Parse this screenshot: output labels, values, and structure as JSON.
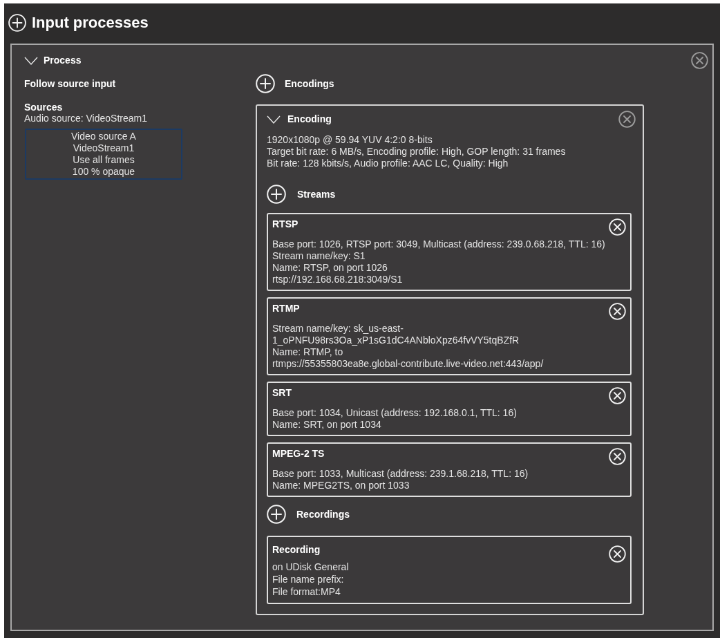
{
  "header": {
    "title": "Input processes"
  },
  "process": {
    "title": "Process",
    "expanded": true,
    "mode": "Follow source input",
    "sources": {
      "title": "Sources",
      "audio": "Audio source: VideoStream1",
      "video": [
        "Video source A",
        "VideoStream1",
        "Use all frames",
        "100 % opaque"
      ]
    },
    "encodings": {
      "title": "Encodings",
      "items": [
        {
          "title": "Encoding",
          "expanded": true,
          "details": [
            "1920x1080p @ 59.94 YUV 4:2:0 8-bits",
            "Target bit rate: 6 MB/s, Encoding profile: High, GOP length: 31 frames",
            "Bit rate: 128 kbits/s, Audio profile: AAC LC, Quality: High"
          ],
          "streams": {
            "title": "Streams",
            "items": [
              {
                "title": "RTSP",
                "lines": [
                  "Base port: 1026, RTSP port: 3049, Multicast (address: 239.0.68.218, TTL: 16)",
                  "Stream name/key: S1",
                  "Name: RTSP, on port 1026",
                  "rtsp://192.168.68.218:3049/S1"
                ]
              },
              {
                "title": "RTMP",
                "lines": [
                  "Stream name/key: sk_us-east-",
                  "1_oPNFU98rs3Oa_xP1sG1dC4ANbloXpz64fvVY5tqBZfR",
                  "Name: RTMP, to",
                  "rtmps://55355803ea8e.global-contribute.live-video.net:443/app/"
                ]
              },
              {
                "title": "SRT",
                "lines": [
                  "Base port: 1034, Unicast (address: 192.168.0.1, TTL: 16)",
                  "Name: SRT, on port 1034"
                ]
              },
              {
                "title": "MPEG-2 TS",
                "lines": [
                  "Base port: 1033, Multicast (address: 239.1.68.218, TTL: 16)",
                  "Name: MPEG2TS, on port 1033"
                ]
              }
            ]
          },
          "recordings": {
            "title": "Recordings",
            "items": [
              {
                "title": "Recording",
                "lines": [
                  "on UDisk General",
                  "File name prefix:",
                  "File format:MP4"
                ]
              }
            ]
          }
        }
      ]
    }
  }
}
